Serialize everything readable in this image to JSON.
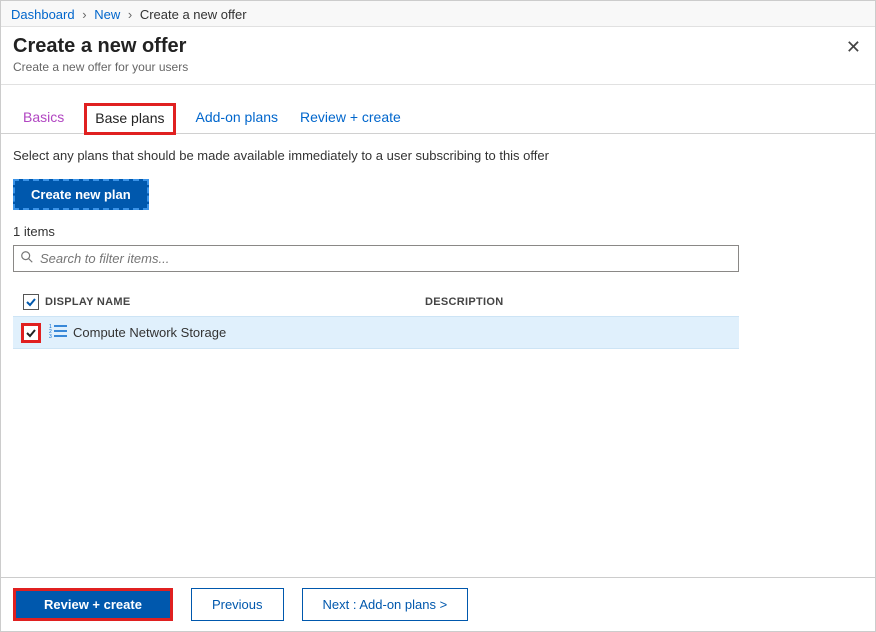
{
  "breadcrumb": {
    "items": [
      "Dashboard",
      "New",
      "Create a new offer"
    ]
  },
  "header": {
    "title": "Create a new offer",
    "subtitle": "Create a new offer for your users"
  },
  "tabs": {
    "basics": "Basics",
    "base_plans": "Base plans",
    "addon_plans": "Add-on plans",
    "review_create": "Review + create"
  },
  "instruction": "Select any plans that should be made available immediately to a user subscribing to this offer",
  "buttons": {
    "create_plan": "Create new plan",
    "review_create": "Review + create",
    "previous": "Previous",
    "next": "Next : Add-on plans >"
  },
  "list": {
    "count_label": "1 items",
    "search_placeholder": "Search to filter items...",
    "columns": {
      "name": "DISPLAY NAME",
      "description": "DESCRIPTION"
    },
    "rows": [
      {
        "name": "Compute Network Storage",
        "checked": true
      }
    ]
  }
}
